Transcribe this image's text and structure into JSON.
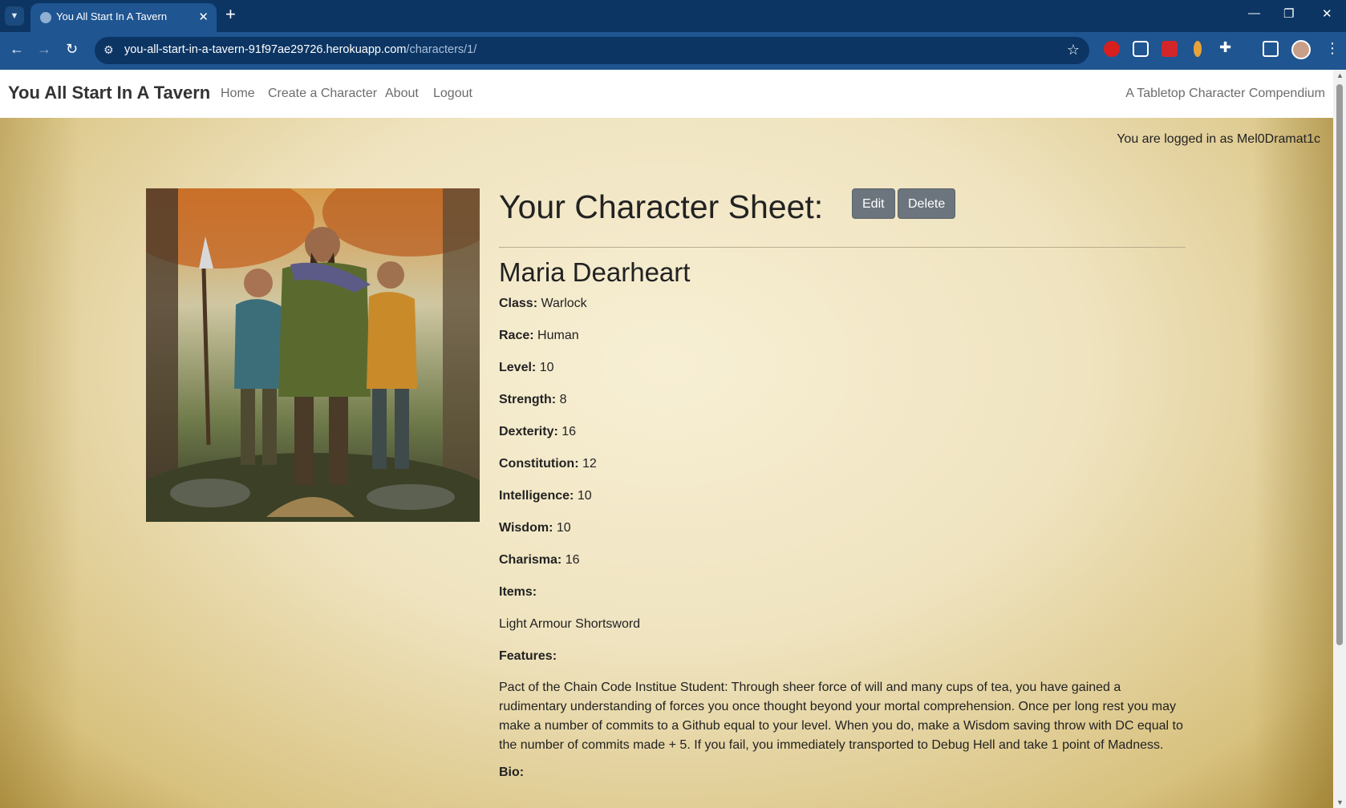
{
  "browser": {
    "tab_title": "You All Start In A Tavern",
    "url_host": "you-all-start-in-a-tavern-91f97ae29726.herokuapp.com",
    "url_path": "/characters/1/"
  },
  "site": {
    "brand": "You All Start In A Tavern",
    "nav": [
      "Home",
      "Create a Character",
      "About",
      "Logout"
    ],
    "tagline": "A Tabletop Character Compendium",
    "logged_in": "You are logged in as Mel0Dramat1c"
  },
  "sheet": {
    "title": "Your Character Sheet:",
    "edit_label": "Edit",
    "delete_label": "Delete",
    "name": "Maria Dearheart",
    "fields": [
      {
        "label": "Class:",
        "value": "Warlock"
      },
      {
        "label": "Race:",
        "value": "Human"
      },
      {
        "label": "Level:",
        "value": "10"
      },
      {
        "label": "Strength:",
        "value": "8"
      },
      {
        "label": "Dexterity:",
        "value": "16"
      },
      {
        "label": "Constitution:",
        "value": "12"
      },
      {
        "label": "Intelligence:",
        "value": "10"
      },
      {
        "label": "Wisdom:",
        "value": "10"
      },
      {
        "label": "Charisma:",
        "value": "16"
      }
    ],
    "items_label": "Items:",
    "items_value": "Light Armour Shortsword",
    "features_label": "Features:",
    "features_value": "Pact of the Chain Code Institue Student: Through sheer force of will and many cups of tea, you have gained a rudimentary understanding of forces you once thought beyond your mortal comprehension. Once per long rest you may make a number of commits to a Github equal to your level. When you do, make a Wisdom saving throw with DC equal to the number of commits made + 5. If you fail, you immediately transported to Debug Hell and take 1 point of Madness.",
    "bio_label": "Bio:"
  },
  "colors": {
    "chrome_dark": "#0c3563",
    "chrome": "#1f5591",
    "button": "#6c757d",
    "parchment": "#eadfb9"
  }
}
